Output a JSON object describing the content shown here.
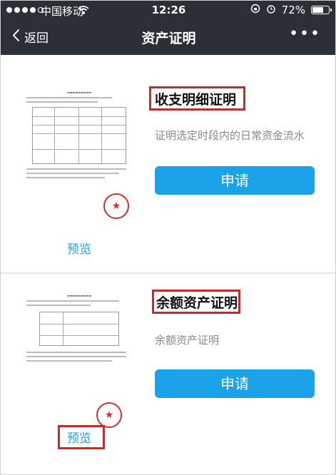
{
  "status_bar": {
    "carrier": "中国移动",
    "time": "12:26",
    "battery": "72%",
    "battery_level": 0.72
  },
  "nav": {
    "back_label": "返回",
    "title": "资产证明",
    "more_label": "•••"
  },
  "income_card": {
    "title": "收支明细证明",
    "description": "证明选定时段内的日常资金流水",
    "apply_label": "申请",
    "preview_label": "预览"
  },
  "balance_card": {
    "title": "余额资产证明",
    "description": "余额资产证明",
    "apply_label": "申请",
    "preview_label": "预览"
  },
  "colors": {
    "accent": "#1aa3e8",
    "header": "#2b2f36",
    "highlight": "#c62b2b"
  }
}
